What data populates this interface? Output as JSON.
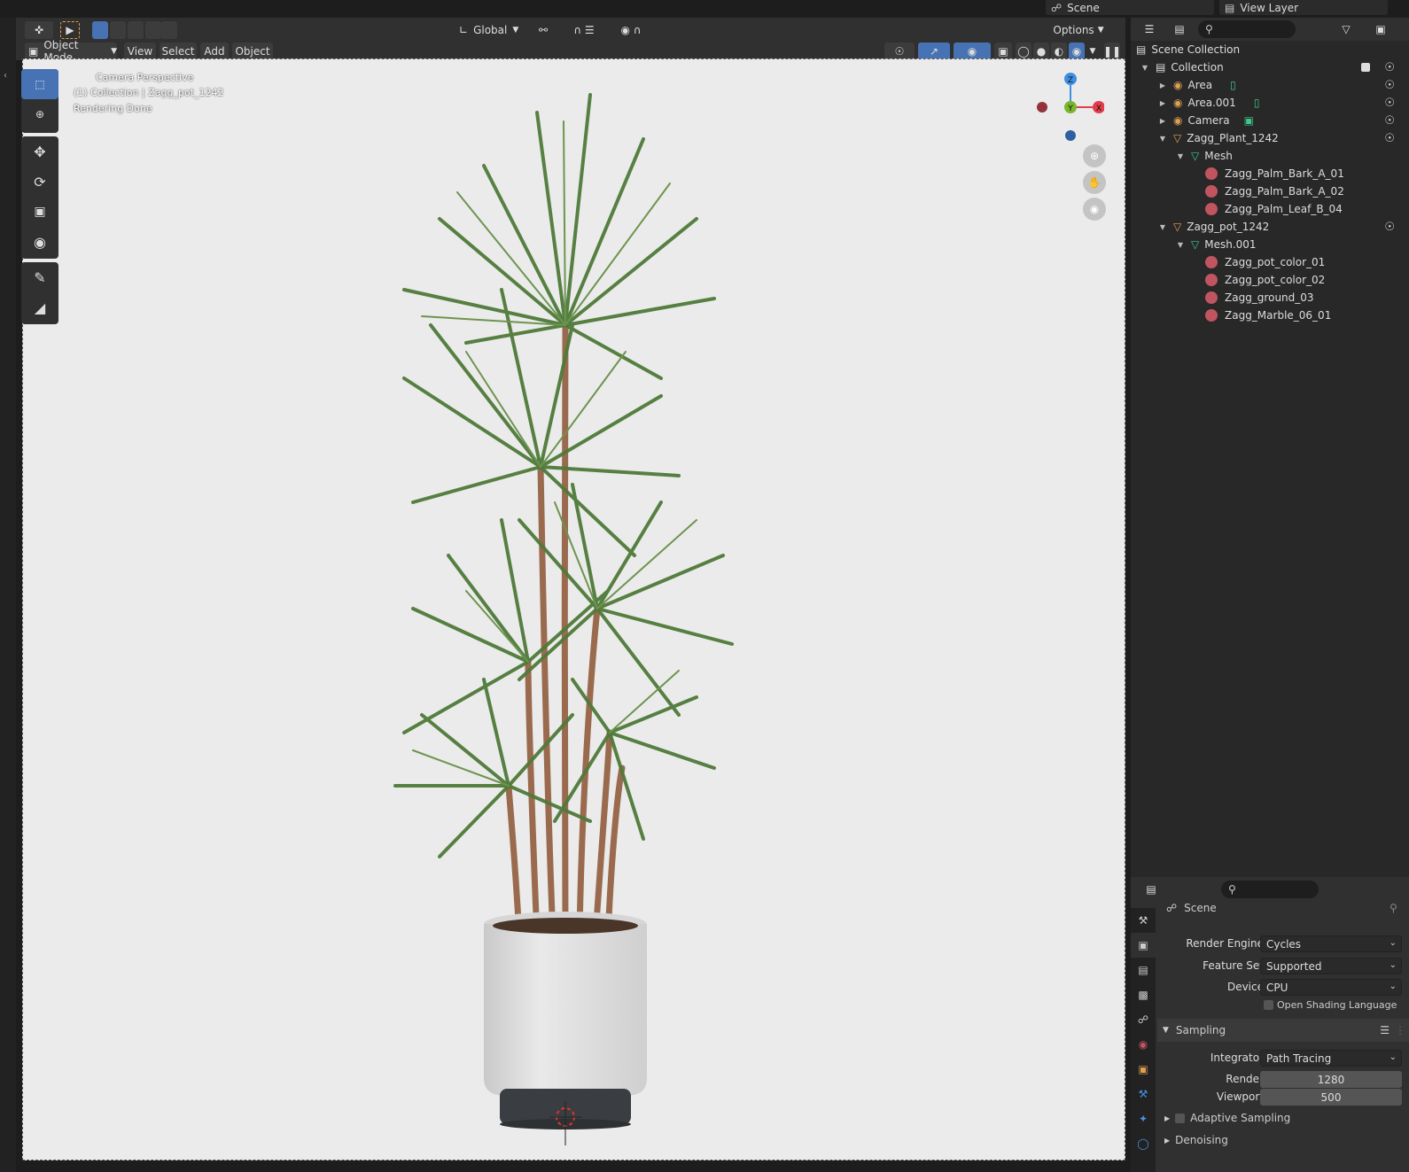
{
  "topbar": {
    "scene_label": "Scene",
    "view_layer_label": "View Layer"
  },
  "header": {
    "transform_orientation": "Global",
    "options_label": "Options",
    "mode_label": "Object Mode",
    "menu": [
      "View",
      "Select",
      "Add",
      "Object"
    ]
  },
  "viewport": {
    "line1": "Camera Perspective",
    "line2": "(1) Collection | Zagg_pot_1242",
    "line3": "Rendering Done",
    "gizmo": {
      "z": "Z",
      "y": "Y",
      "x": "X"
    }
  },
  "outliner": {
    "root": "Scene Collection",
    "collection": "Collection",
    "items": {
      "area": "Area",
      "area001": "Area.001",
      "camera": "Camera",
      "plant": "Zagg_Plant_1242",
      "mesh": "Mesh",
      "mat1": "Zagg_Palm_Bark_A_01",
      "mat2": "Zagg_Palm_Bark_A_02",
      "mat3": "Zagg_Palm_Leaf_B_04",
      "pot": "Zagg_pot_1242",
      "mesh001": "Mesh.001",
      "mat4": "Zagg_pot_color_01",
      "mat5": "Zagg_pot_color_02",
      "mat6": "Zagg_ground_03",
      "mat7": "Zagg_Marble_06_01"
    }
  },
  "properties": {
    "context": "Scene",
    "render_engine_label": "Render Engine",
    "render_engine": "Cycles",
    "feature_set_label": "Feature Set",
    "feature_set": "Supported",
    "device_label": "Device",
    "device": "CPU",
    "osl_label": "Open Shading Language",
    "sampling_label": "Sampling",
    "integrator_label": "Integrator",
    "integrator": "Path Tracing",
    "render_label": "Render",
    "render_samples": "1280",
    "viewport_label": "Viewport",
    "viewport_samples": "500",
    "adaptive_label": "Adaptive Sampling",
    "denoising_label": "Denoising"
  },
  "colors": {
    "accent": "#4772b3",
    "x_axis": "#e03c4c",
    "y_axis": "#7ab52e",
    "z_axis": "#3d8fe0"
  }
}
